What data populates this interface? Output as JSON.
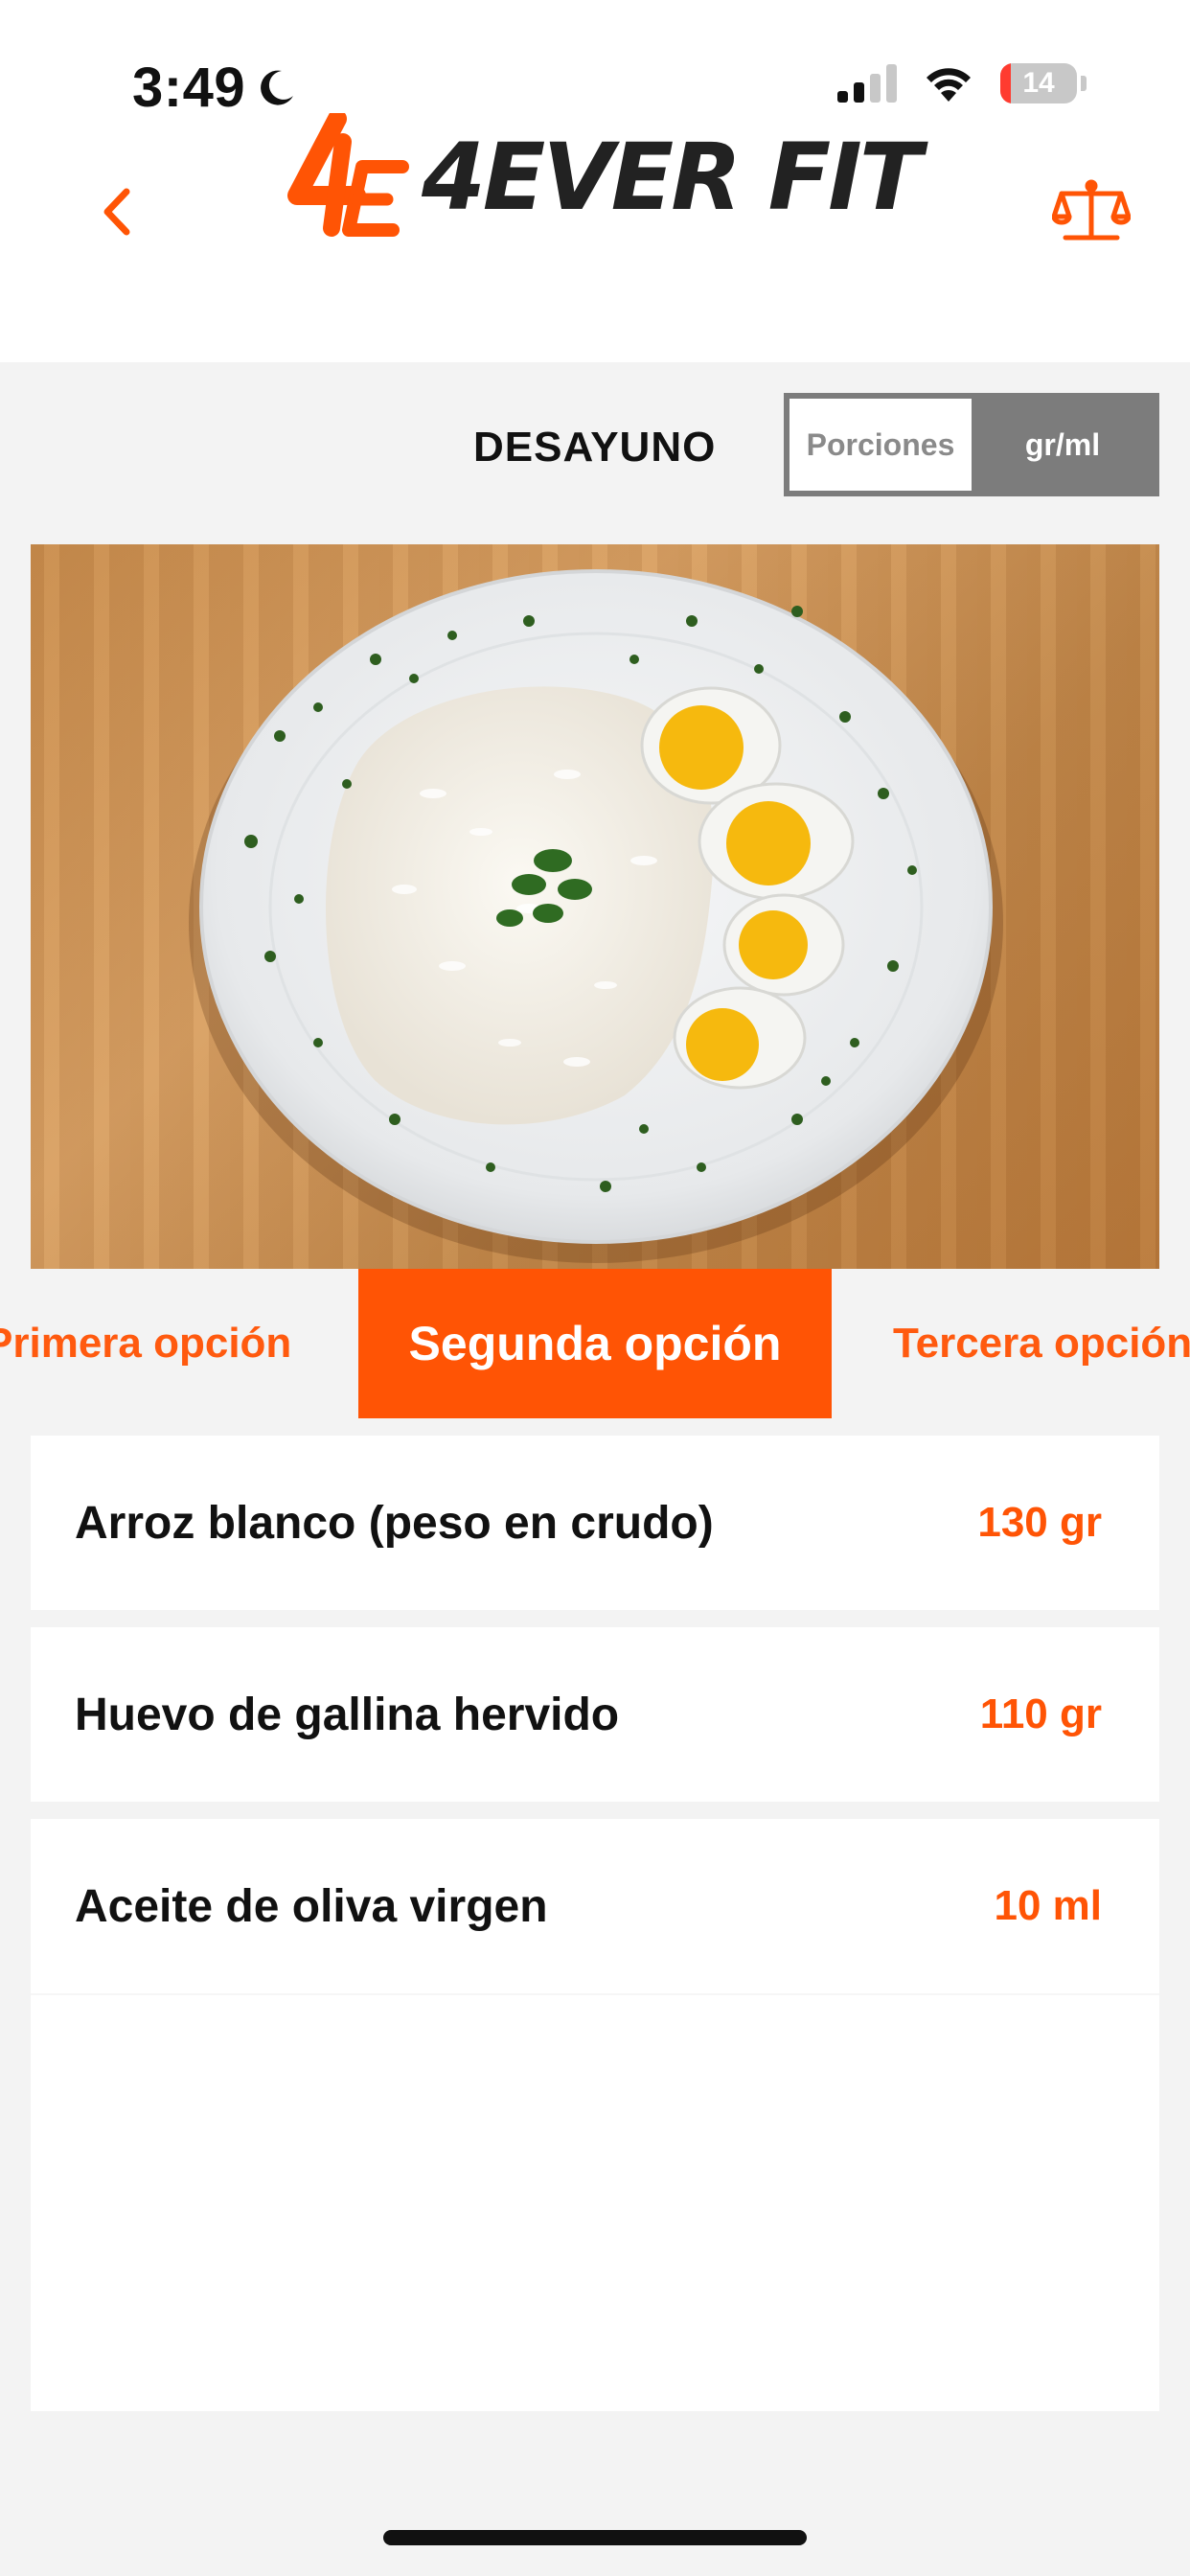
{
  "status_bar": {
    "time": "3:49",
    "battery": "14",
    "battery_level": 0.14
  },
  "header": {
    "logo_text": "4EVER FIT",
    "logo_mark": "4E"
  },
  "meal": {
    "title": "DESAYUNO"
  },
  "unit_toggle": {
    "options": [
      "Porciones",
      "gr/ml"
    ],
    "selected": "gr/ml"
  },
  "options_tabs": {
    "items": [
      "Primera opción",
      "Segunda opción",
      "Tercera opción"
    ],
    "selected": "Segunda opción"
  },
  "ingredients": [
    {
      "name": "Arroz blanco (peso en crudo)",
      "amount": "130 gr"
    },
    {
      "name": "Huevo de gallina hervido",
      "amount": "110 gr"
    },
    {
      "name": "Aceite de oliva virgen",
      "amount": "10 ml"
    }
  ],
  "colors": {
    "accent": "#ff5405",
    "toggle_gray": "#7c7c7c",
    "background": "#f3f3f3"
  },
  "icons": [
    "moon-icon",
    "cellular-signal-icon",
    "wifi-icon",
    "battery-icon",
    "back-chevron-icon",
    "scale-icon"
  ]
}
